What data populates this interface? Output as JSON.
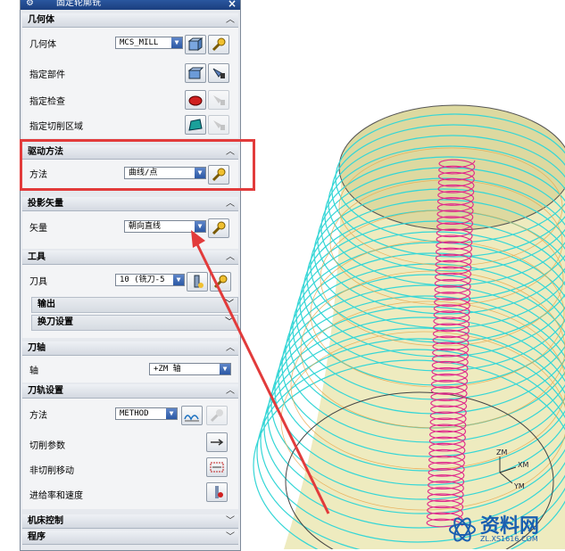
{
  "dialog": {
    "title": "固定轮廓铣",
    "close_glyph": "×",
    "sections": {
      "geometry": {
        "header": "几何体",
        "geometry_label": "几何体",
        "geometry_value": "MCS_MILL",
        "specify_part_label": "指定部件",
        "specify_check_label": "指定检查",
        "specify_cut_area_label": "指定切削区域"
      },
      "drive_method": {
        "header": "驱动方法",
        "method_label": "方法",
        "method_value": "曲线/点"
      },
      "projection_vector": {
        "header": "投影矢量",
        "vector_label": "矢量",
        "vector_value": "朝向直线"
      },
      "tool": {
        "header": "工具",
        "tool_label": "刀具",
        "tool_value": "10 (铣刀-5",
        "output_label": "输出",
        "tool_change_label": "换刀设置"
      },
      "tool_axis": {
        "header": "刀轴",
        "axis_label": "轴",
        "axis_value": "+ZM 轴"
      },
      "path_settings": {
        "header": "刀轨设置",
        "method_label": "方法",
        "method_value": "METHOD",
        "cut_params_label": "切削参数",
        "non_cut_moves_label": "非切削移动",
        "feeds_speeds_label": "进给率和速度"
      },
      "machine_control": {
        "header": "机床控制"
      },
      "program": {
        "header": "程序"
      }
    }
  },
  "viewport": {
    "axis_labels": {
      "zm": "ZM",
      "xm": "XM",
      "ym": "YM"
    },
    "colors": {
      "cylinder_rings": "#35d6d6",
      "cylinder_fill": "#d9d79a",
      "helix": "#e0288a",
      "highlight": "#e23b3b"
    }
  },
  "watermark": {
    "text": "资料网",
    "url": "ZL.XS1616.COM"
  }
}
